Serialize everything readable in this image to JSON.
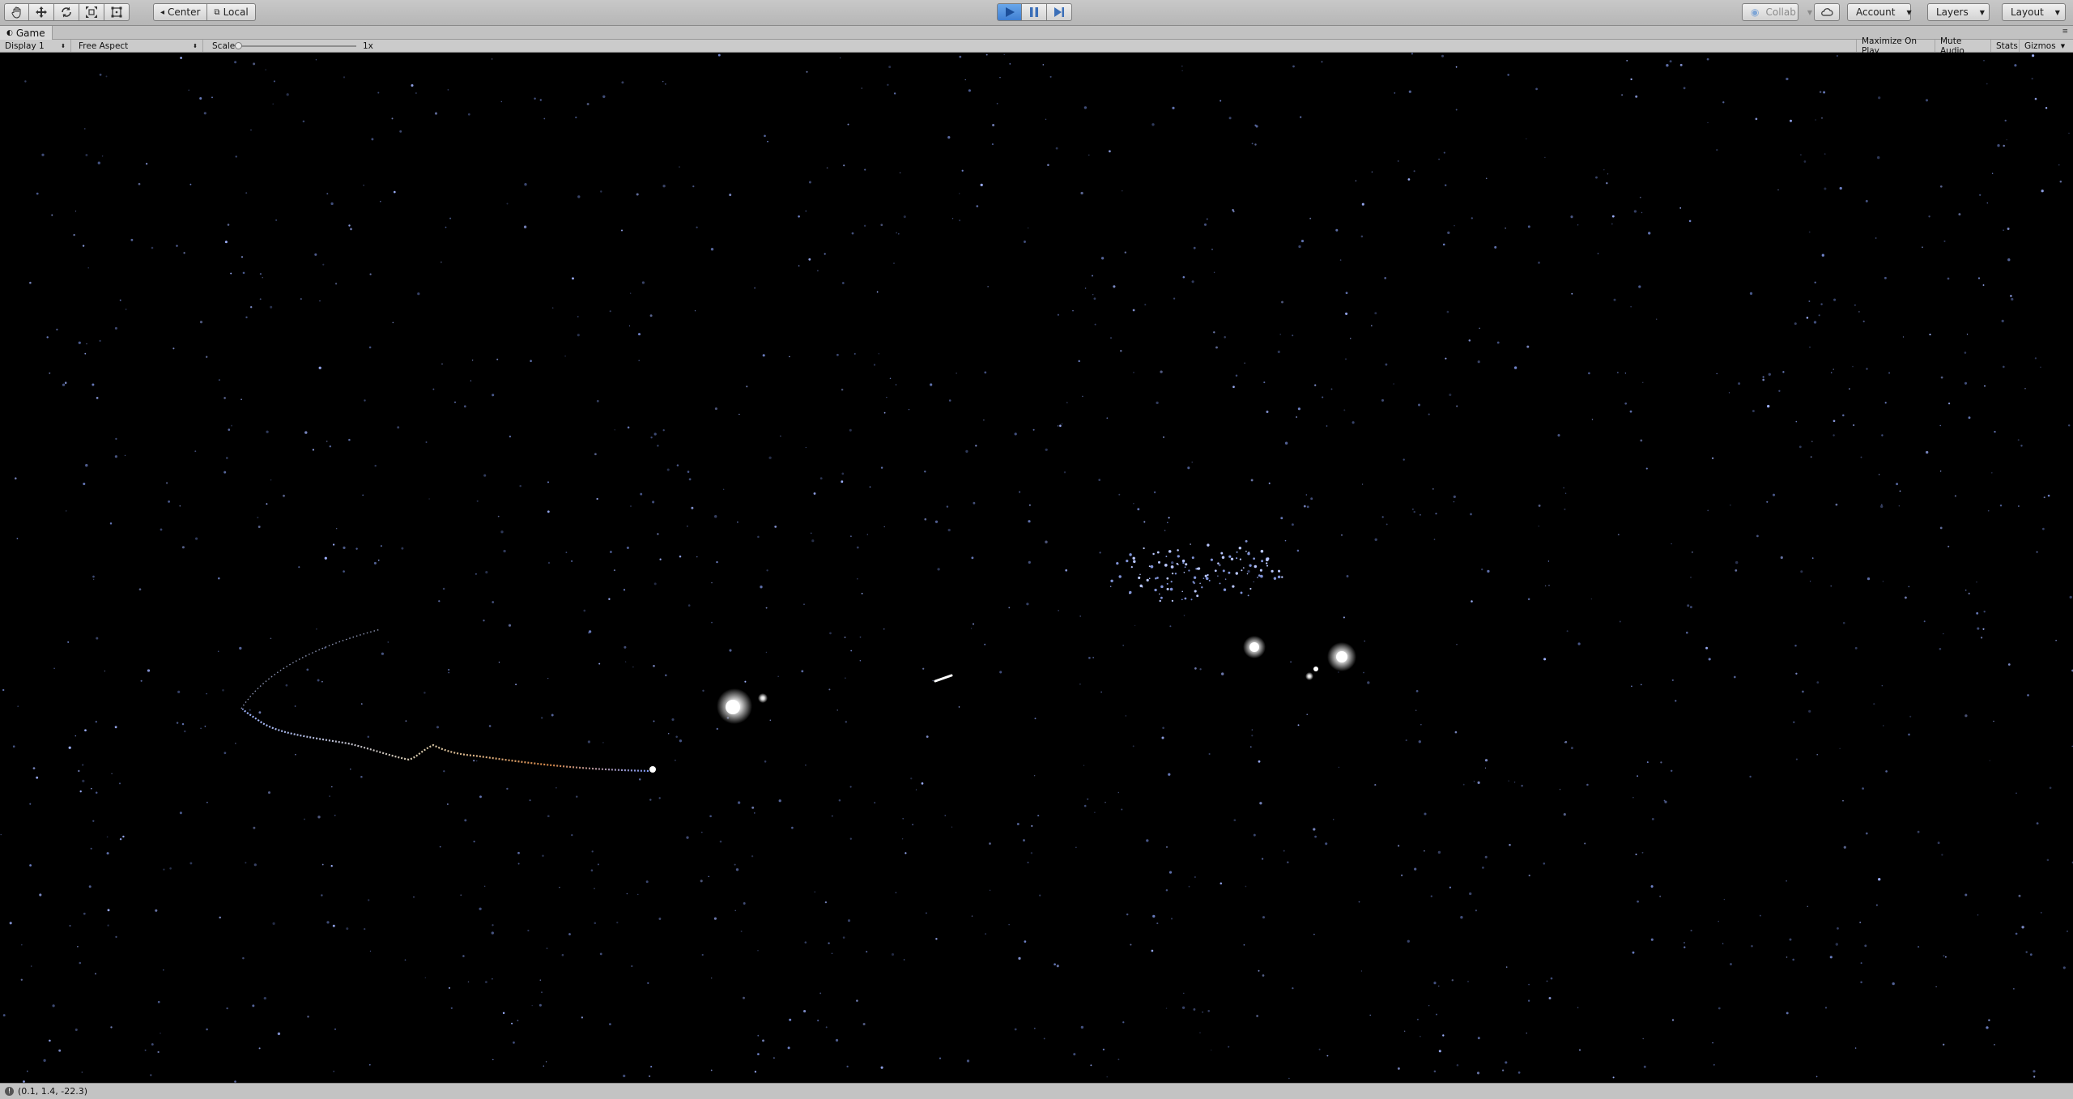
{
  "toolbar": {
    "tools": [
      {
        "name": "hand-tool",
        "icon": "hand-icon"
      },
      {
        "name": "move-tool",
        "icon": "move-arrows-icon"
      },
      {
        "name": "rotate-tool",
        "icon": "rotate-icon"
      },
      {
        "name": "scale-tool",
        "icon": "scale-icon"
      },
      {
        "name": "rect-tool",
        "icon": "rect-transform-icon"
      }
    ],
    "pivot_label": "Center",
    "space_label": "Local",
    "play_state": "playing",
    "collab_label": "Collab",
    "account_label": "Account",
    "layers_label": "Layers",
    "layout_label": "Layout",
    "accent_color": "#3f7fd3"
  },
  "tab": {
    "title": "Game"
  },
  "game_toolbar": {
    "display": "Display 1",
    "aspect": "Free Aspect",
    "scale_label": "Scale",
    "scale_value": "1x",
    "maximize_on_play": "Maximize On Play",
    "mute_audio": "Mute Audio",
    "stats": "Stats",
    "gizmos": "Gizmos"
  },
  "status": {
    "message": "(0.1, 1.4, -22.3)"
  }
}
